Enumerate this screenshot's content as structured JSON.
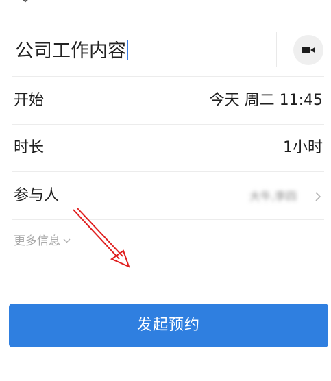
{
  "icons": {
    "top": "chevron-down-icon",
    "video": "video-camera-icon",
    "participants_chevron": "chevron-right-icon",
    "more_info_chevron": "chevron-down-small-icon"
  },
  "meeting": {
    "title": "公司工作内容"
  },
  "rows": {
    "start": {
      "label": "开始",
      "value": "今天 周二 11:45"
    },
    "duration": {
      "label": "时长",
      "value": "1小时"
    },
    "participants": {
      "label": "参与人",
      "value": "大牛,李四"
    }
  },
  "more_info": {
    "label": "更多信息"
  },
  "submit": {
    "label": "发起预约"
  },
  "colors": {
    "accent": "#2f7fe0",
    "annotation_arrow": "#e02020"
  }
}
